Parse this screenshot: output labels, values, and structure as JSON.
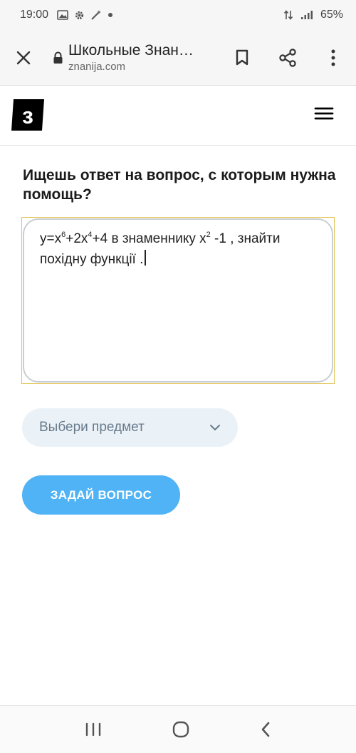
{
  "status_bar": {
    "time": "19:00",
    "battery": "65%"
  },
  "browser": {
    "page_title": "Школьные Знан…",
    "domain": "znanija.com"
  },
  "site": {
    "logo_letter": "з"
  },
  "main": {
    "heading": "Ищешь ответ на вопрос, с которым нужна помощь?",
    "question": {
      "p1": "y=x",
      "s1": "6",
      "p2": "+2x",
      "s2": "4",
      "p3": "+4 в знаменнику x",
      "s3": "2",
      "p4": " -1 , знайти похідну функції ."
    },
    "subject_placeholder": "Выбери предмет",
    "ask_button": "ЗАДАЙ ВОПРОС"
  },
  "colors": {
    "accent_blue": "#4fb3f6",
    "subject_bg": "#ebf2f7",
    "focus_outline": "#e1c24f"
  },
  "icons": {
    "status": [
      "gallery-icon",
      "settings-icon",
      "magic-wand-icon",
      "dot-icon"
    ],
    "status_right": [
      "data-arrows-icon",
      "signal-icon"
    ],
    "browser": [
      "close-icon",
      "lock-icon",
      "bookmark-icon",
      "share-icon",
      "more-vert-icon"
    ],
    "site": [
      "menu-icon"
    ],
    "subject": [
      "chevron-down-icon"
    ],
    "nav": [
      "recent-apps-icon",
      "home-icon",
      "back-icon"
    ]
  }
}
